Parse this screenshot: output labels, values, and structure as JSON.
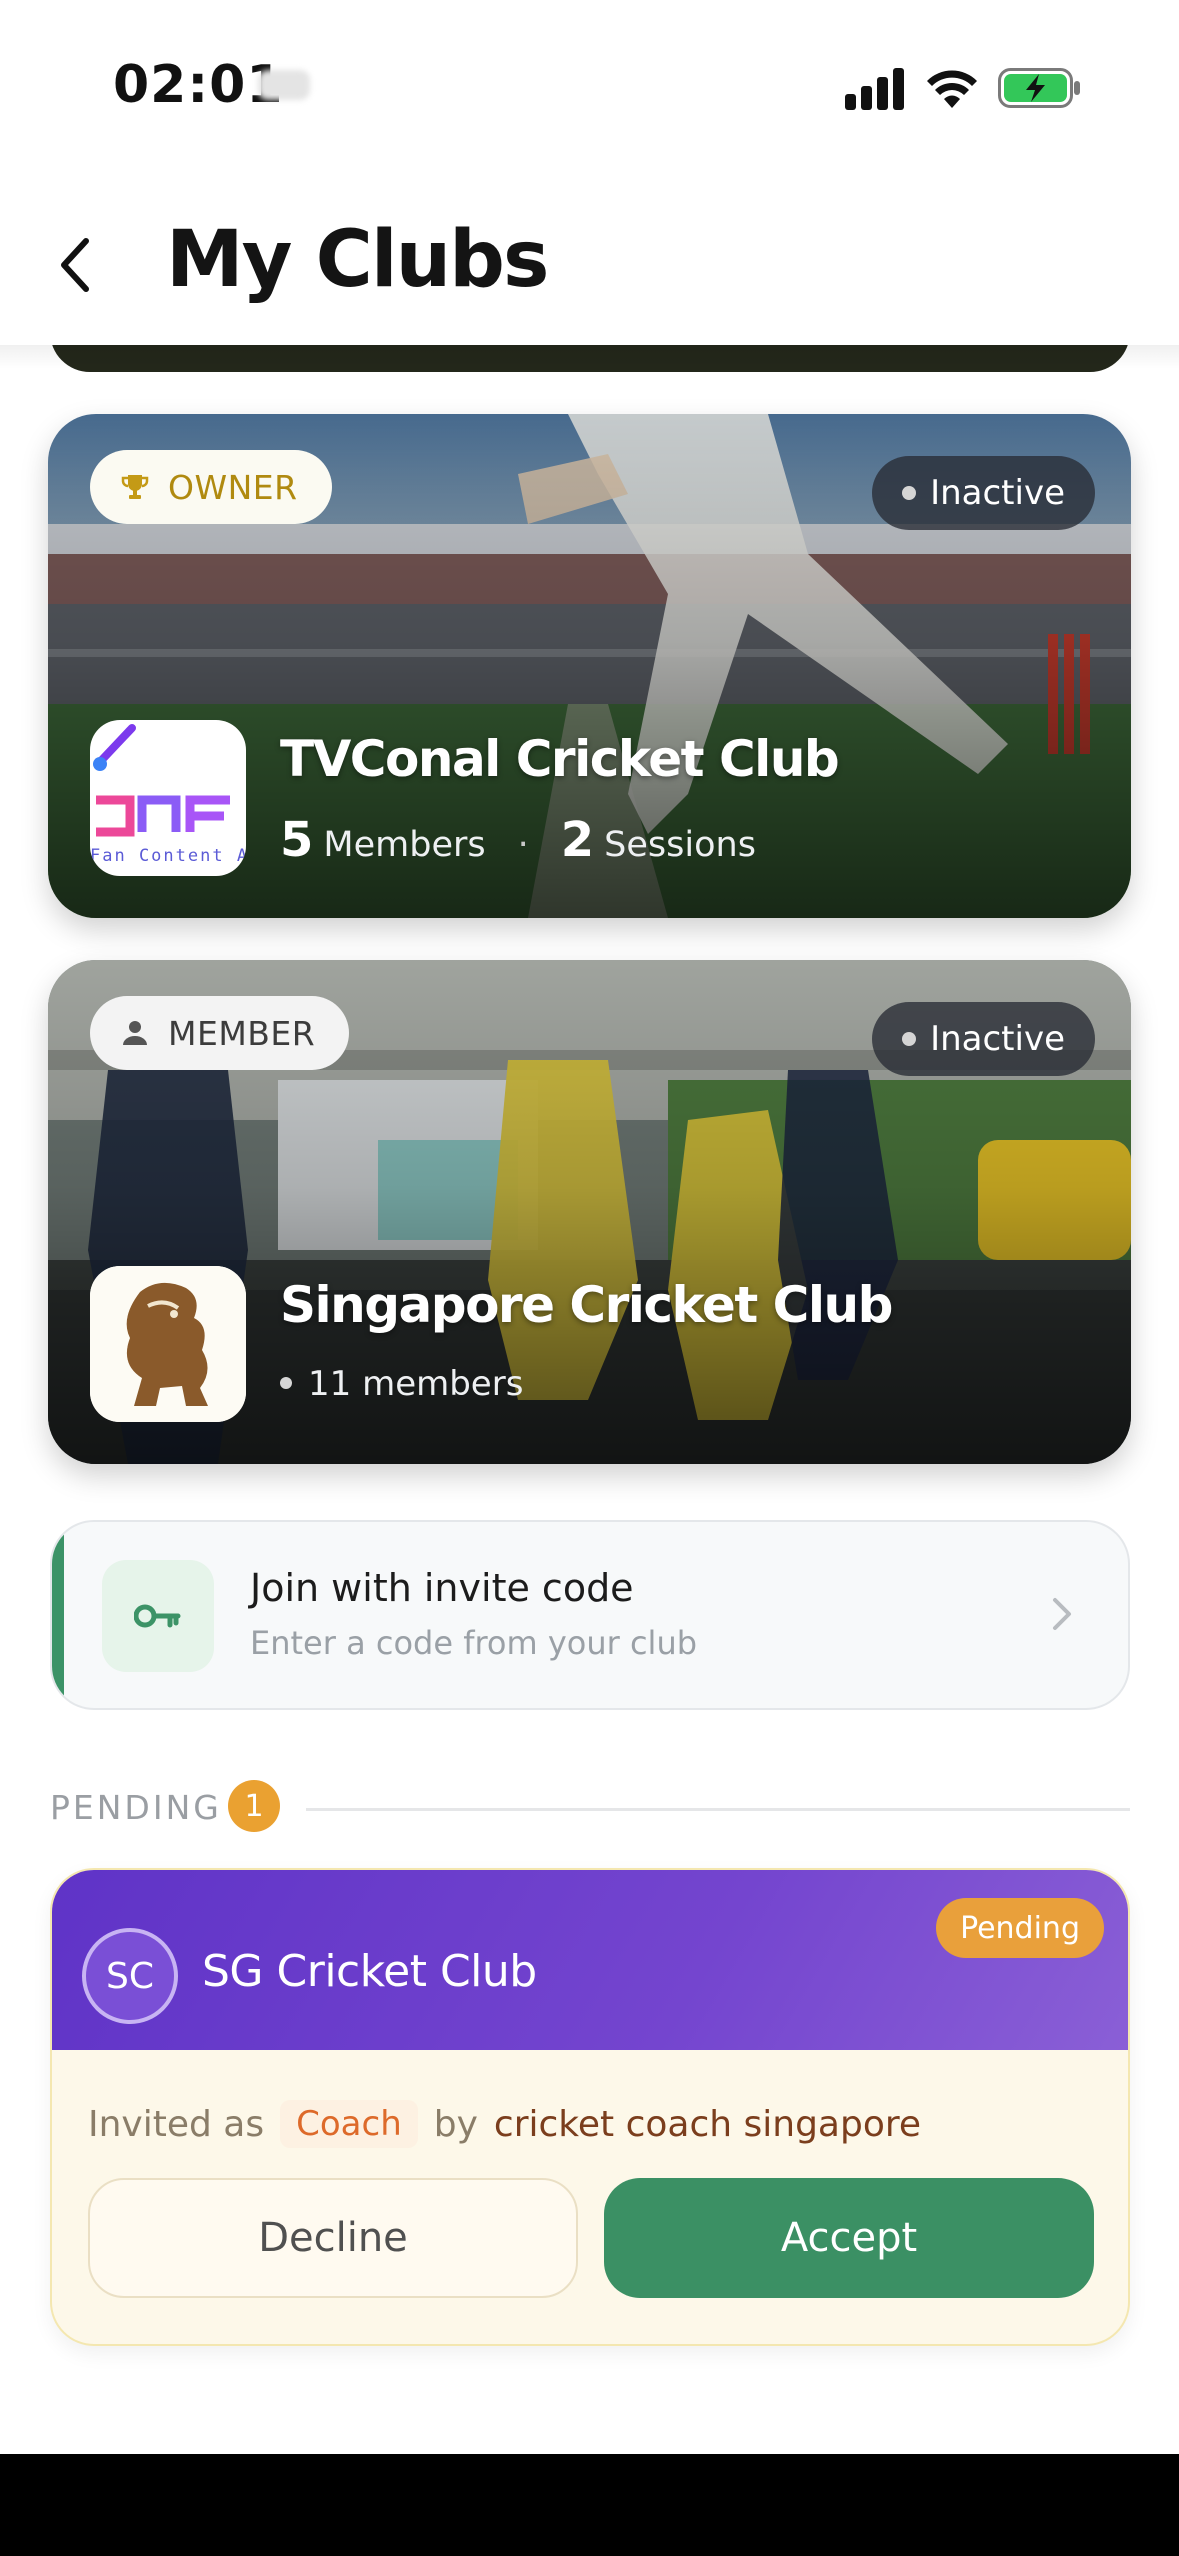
{
  "status_bar": {
    "time": "02:01",
    "icons": [
      "signal-icon",
      "wifi-icon",
      "battery-charging-icon"
    ]
  },
  "header": {
    "title": "My Clubs",
    "back_icon": "chevron-left-icon"
  },
  "clubs": [
    {
      "role": "OWNER",
      "role_icon": "trophy-icon",
      "status": "Inactive",
      "name": "TVConal Cricket Club",
      "logo_text": "Fan Content A",
      "members_count": "5",
      "members_label": "Members",
      "separator": "·",
      "sessions_count": "2",
      "sessions_label": "Sessions"
    },
    {
      "role": "MEMBER",
      "role_icon": "person-icon",
      "status": "Inactive",
      "name": "Singapore Cricket Club",
      "members_text": "11 members"
    }
  ],
  "invite_code": {
    "title": "Join with invite code",
    "subtitle": "Enter a code from your club",
    "icon": "key-icon",
    "chevron": "chevron-right-icon",
    "accent_color": "#3c9367"
  },
  "pending": {
    "label": "PENDING",
    "count": "1",
    "items": [
      {
        "initials": "SC",
        "club": "SG Cricket Club",
        "status_chip": "Pending",
        "invited_as_label": "Invited as",
        "role": "Coach",
        "by_label": "by",
        "invited_by": "cricket coach singapore",
        "decline_label": "Decline",
        "accept_label": "Accept"
      }
    ]
  },
  "colors": {
    "accept": "#3b9064",
    "pending_chip": "#e9a03b",
    "invite_header": "#6a3bcb",
    "owner_badge_text": "#b08a10"
  }
}
